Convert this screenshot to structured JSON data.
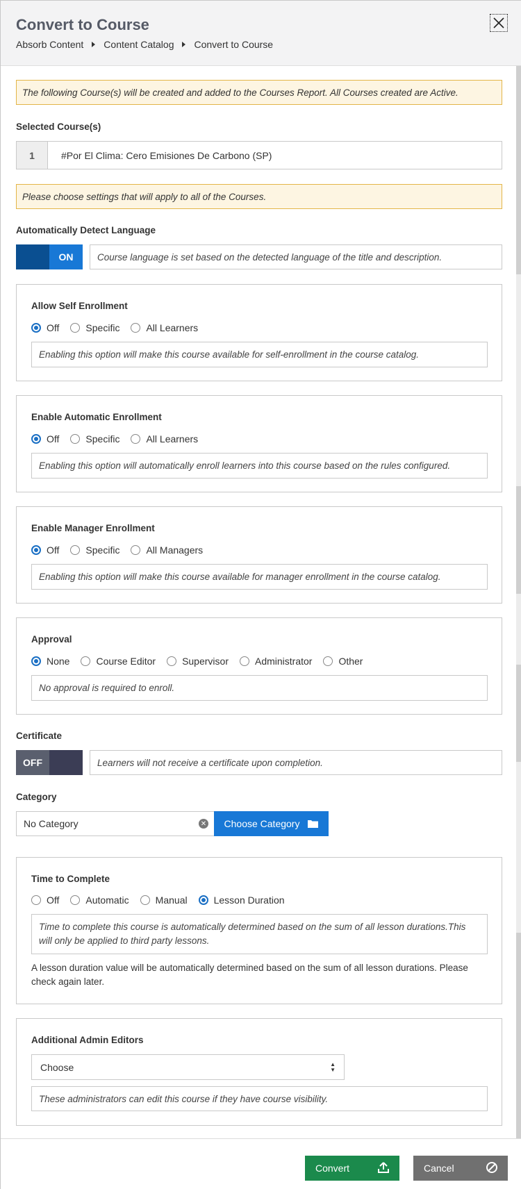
{
  "header": {
    "title": "Convert to Course",
    "breadcrumbs": [
      "Absorb Content",
      "Content Catalog",
      "Convert to Course"
    ]
  },
  "notices": {
    "created": "The following Course(s) will be created and added to the Courses Report. All Courses created are Active.",
    "settings": "Please choose settings that will apply to all of the Courses."
  },
  "selected": {
    "label": "Selected Course(s)",
    "courses": [
      {
        "num": "1",
        "name": "#Por El Clima: Cero Emisiones De Carbono (SP)"
      }
    ]
  },
  "language": {
    "label": "Automatically Detect Language",
    "toggle": "ON",
    "desc": "Course language is set based on the detected language of the title and description."
  },
  "self_enrollment": {
    "title": "Allow Self Enrollment",
    "options": [
      "Off",
      "Specific",
      "All Learners"
    ],
    "selected": "Off",
    "desc": "Enabling this option will make this course available for self-enrollment in the course catalog."
  },
  "auto_enrollment": {
    "title": "Enable Automatic Enrollment",
    "options": [
      "Off",
      "Specific",
      "All Learners"
    ],
    "selected": "Off",
    "desc": "Enabling this option will automatically enroll learners into this course based on the rules configured."
  },
  "manager_enrollment": {
    "title": "Enable Manager Enrollment",
    "options": [
      "Off",
      "Specific",
      "All Managers"
    ],
    "selected": "Off",
    "desc": "Enabling this option will make this course available for manager enrollment in the course catalog."
  },
  "approval": {
    "title": "Approval",
    "options": [
      "None",
      "Course Editor",
      "Supervisor",
      "Administrator",
      "Other"
    ],
    "selected": "None",
    "desc": "No approval is required to enroll."
  },
  "certificate": {
    "label": "Certificate",
    "toggle": "OFF",
    "desc": "Learners will not receive a certificate upon completion."
  },
  "category": {
    "label": "Category",
    "value": "No Category",
    "button": "Choose Category"
  },
  "time_to_complete": {
    "title": "Time to Complete",
    "options": [
      "Off",
      "Automatic",
      "Manual",
      "Lesson Duration"
    ],
    "selected": "Lesson Duration",
    "desc": "Time to complete this course is automatically determined based on the sum of all lesson durations.This will only be applied to third party lessons.",
    "note": "A lesson duration value will be automatically determined based on the sum of all lesson durations. Please check again later."
  },
  "admin_editors": {
    "title": "Additional Admin Editors",
    "select_value": "Choose",
    "desc": "These administrators can edit this course if they have course visibility."
  },
  "footer": {
    "convert": "Convert",
    "cancel": "Cancel"
  },
  "colors": {
    "primary": "#1878d6",
    "convert": "#1b8a4c",
    "cancel": "#707070",
    "notice_bg": "#fdf5e2",
    "notice_border": "#e3b548"
  }
}
